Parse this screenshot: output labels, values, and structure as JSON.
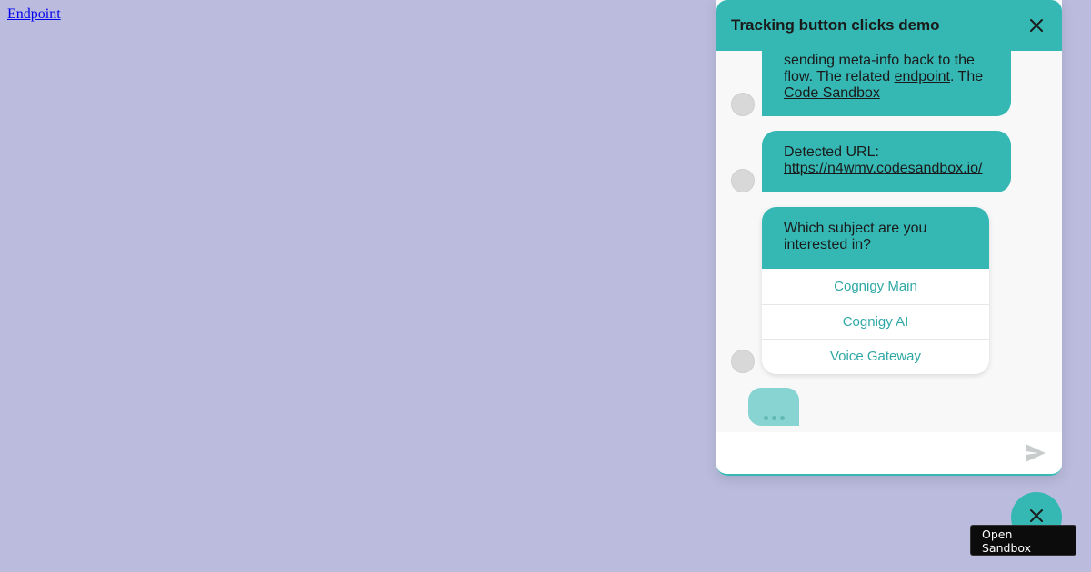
{
  "page": {
    "link_label": "Endpoint"
  },
  "colors": {
    "background": "#bbbbdd",
    "accent": "#35b8b4",
    "quick_reply_text": "#2fa8a5",
    "link": "#0000ee"
  },
  "webchat": {
    "title": "Tracking button clicks demo",
    "close_icon": "close-icon",
    "messages": [
      {
        "line1": "sending meta-info back to the",
        "line2_pre": "flow. The related ",
        "line2_link": "endpoint",
        "line2_post": ". The",
        "line3_link": "Code Sandbox"
      },
      {
        "line1": "Detected URL:",
        "link": "https://n4wmv.codesandbox.io/"
      }
    ],
    "quick_reply": {
      "text": "Which subject are you interested in?",
      "buttons": [
        "Cognigy Main",
        "Cognigy AI",
        "Voice Gateway"
      ]
    },
    "input": {
      "placeholder": "",
      "value": ""
    },
    "send_icon": "send-icon"
  },
  "toggle": {
    "icon": "close-icon"
  },
  "sandbox_button": {
    "line1": "Open",
    "line2": "Sandbox"
  }
}
